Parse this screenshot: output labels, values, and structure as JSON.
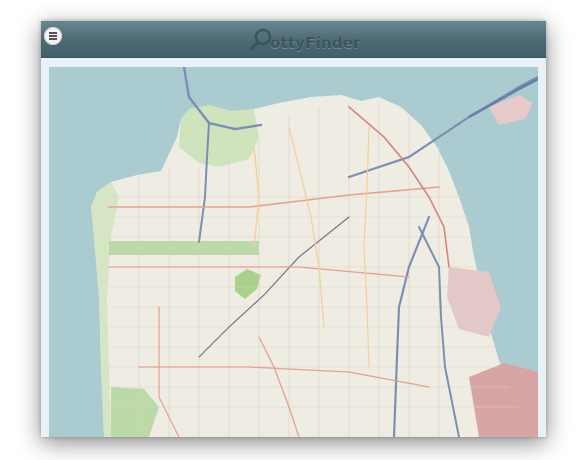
{
  "app": {
    "logo_text": "ottyFinder",
    "accent_color": "#4d6a74"
  },
  "menu_button": {
    "icon": "menu-icon"
  },
  "logo_icon": "magnifier-icon",
  "map": {
    "type": "street-map",
    "water_color": "#aacbd0",
    "land_color": "#efece4"
  }
}
